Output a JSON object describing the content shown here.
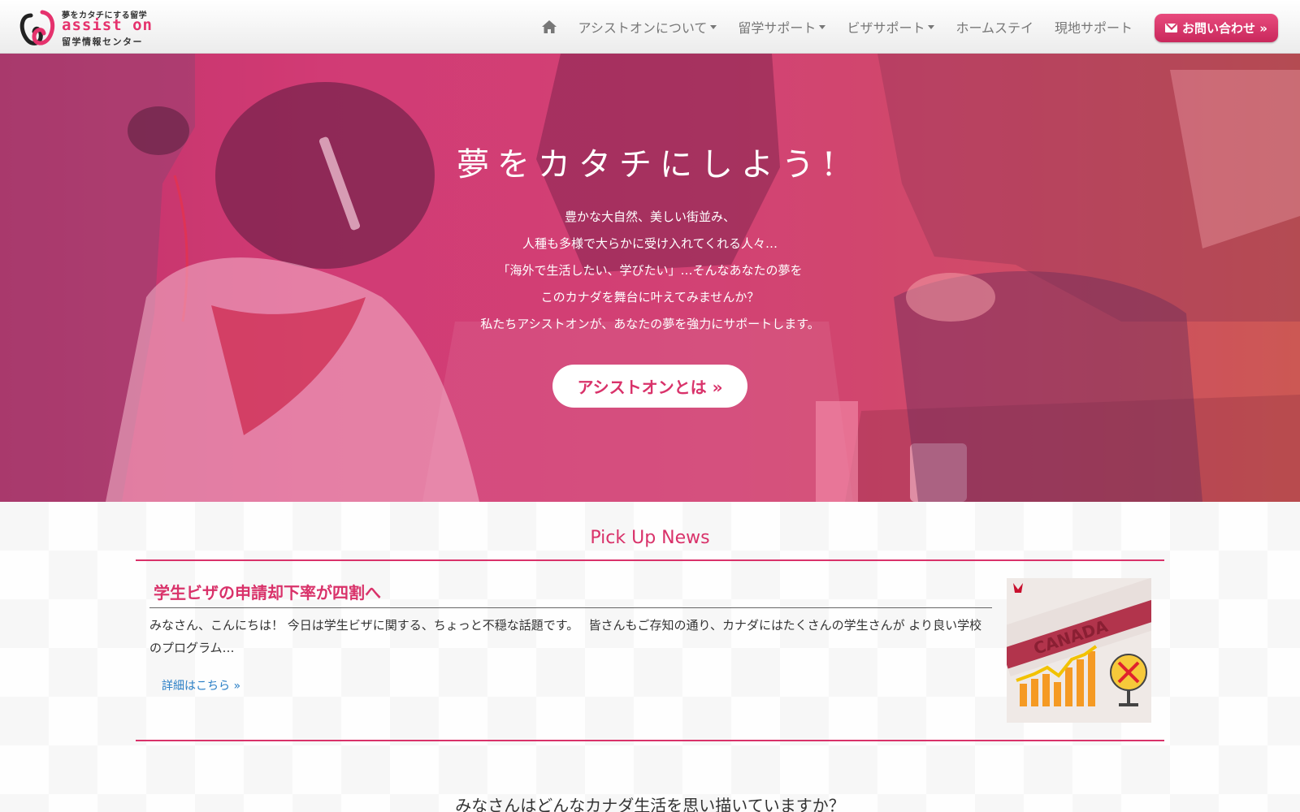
{
  "logo": {
    "tagline": "夢をカタチにする留学",
    "name": "assist on",
    "subtitle": "留学情報センター"
  },
  "nav": {
    "items": [
      {
        "label": "アシストオンについて",
        "dropdown": true
      },
      {
        "label": "留学サポート",
        "dropdown": true
      },
      {
        "label": "ビザサポート",
        "dropdown": true
      },
      {
        "label": "ホームステイ",
        "dropdown": false
      },
      {
        "label": "現地サポート",
        "dropdown": false
      }
    ],
    "contact_label": "お問い合わせ »",
    "home_icon": "home-icon",
    "contact_icon": "envelope-icon"
  },
  "hero": {
    "title": "夢をカタチにしよう!",
    "lines": [
      "豊かな大自然、美しい街並み、",
      "人種も多様で大らかに受け入れてくれる人々…",
      "「海外で生活したい、学びたい」…そんなあなたの夢を",
      "このカナダを舞台に叶えてみませんか？",
      "私たちアシストオンが、あなたの夢を強力にサポートします。"
    ],
    "button_label": "アシストオンとは »"
  },
  "news": {
    "heading": "Pick Up News",
    "article": {
      "title": "学生ビザの申請却下率が四割へ",
      "excerpt": "みなさん、こんにちは！ 今日は学生ビザに関する、ちょっと不穏な話題です。　 皆さんもご存知の通り、カナダにはたくさんの学生さんが より良い学校のプログラム…",
      "read_more": "詳細はこちら »",
      "thumbnail_text": "CANADA"
    }
  },
  "section_question": "みなさんはどんなカナダ生活を思い描いていますか？",
  "colors": {
    "brand_pink": "#d9326a",
    "link_blue": "#2a7fc6"
  }
}
